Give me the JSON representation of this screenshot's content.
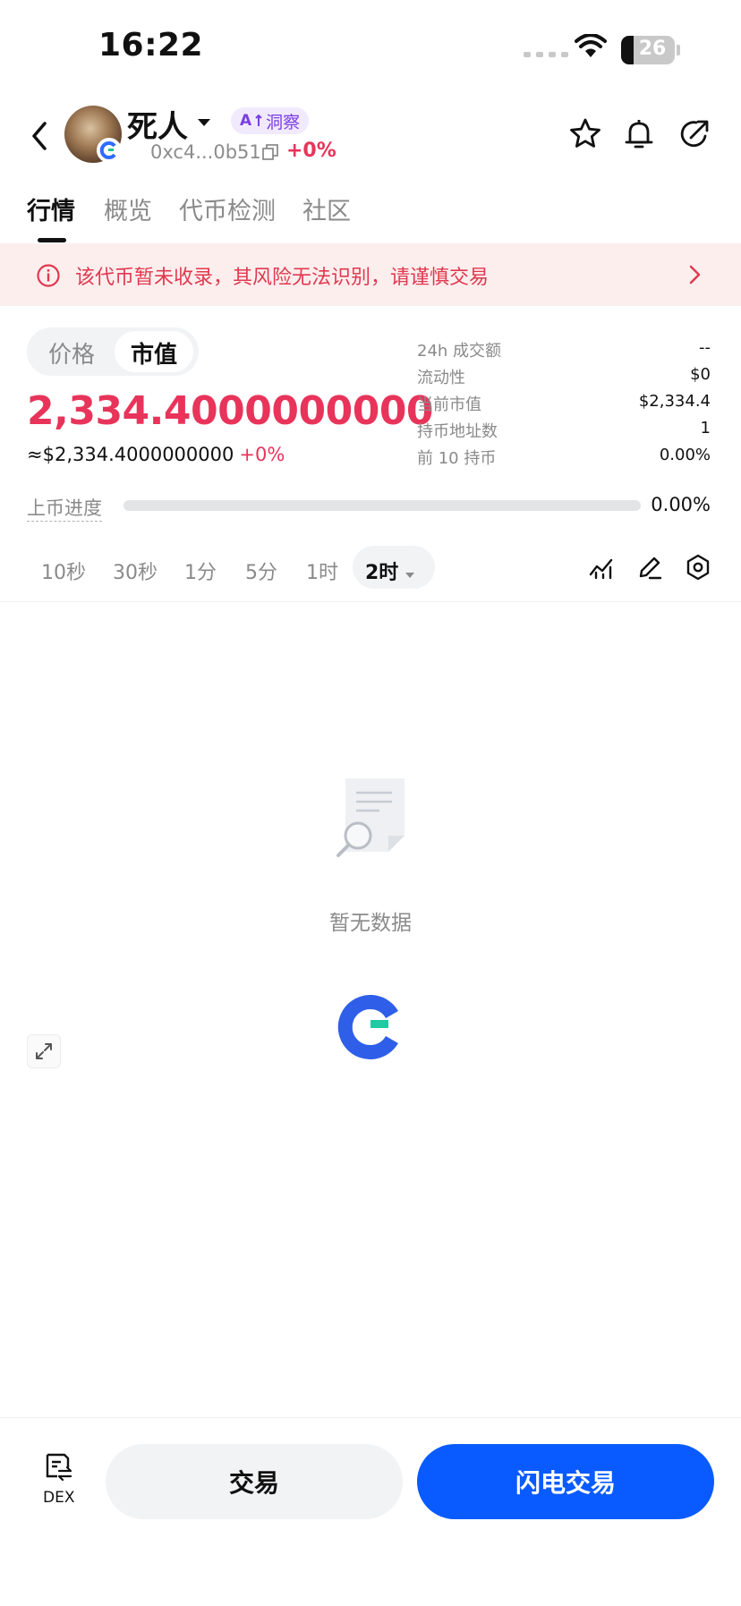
{
  "status_bar": {
    "time": "16:22",
    "battery": "26"
  },
  "header": {
    "token_name": "死人",
    "ai_badge_prefix": "A",
    "ai_badge_label": "洞察",
    "address": "0xc4...0b51",
    "change": "+0%"
  },
  "tabs": [
    {
      "label": "行情",
      "active": true
    },
    {
      "label": "概览",
      "active": false
    },
    {
      "label": "代币检测",
      "active": false
    },
    {
      "label": "社区",
      "active": false
    }
  ],
  "warning": {
    "text": "该代币暂未收录，其风险无法识别，请谨慎交易"
  },
  "price_toggle": {
    "options": [
      "价格",
      "市值"
    ],
    "selected": "市值"
  },
  "main_value": "2,334.4000000000",
  "usd_value": "≈$2,334.4000000000",
  "usd_change": "+0%",
  "stats": [
    {
      "label": "24h 成交额",
      "value": "--"
    },
    {
      "label": "流动性",
      "value": "$0"
    },
    {
      "label": "当前市值",
      "value": "$2,334.4"
    },
    {
      "label": "持币地址数",
      "value": "1"
    },
    {
      "label": "前 10 持币",
      "value": "0.00%"
    }
  ],
  "progress": {
    "label": "上币进度",
    "value_text": "0.00%",
    "fraction": 0.0
  },
  "intervals": {
    "items": [
      "10秒",
      "30秒",
      "1分",
      "5分",
      "1时",
      "2时"
    ],
    "selected": "2时"
  },
  "chart": {
    "empty_text": "暂无数据"
  },
  "bottom_bar": {
    "dex_label": "DEX",
    "trade_label": "交易",
    "flash_trade_label": "闪电交易"
  },
  "colors": {
    "accent_red": "#e8345a",
    "primary_blue": "#0a5bff",
    "warning_bg": "#fdeeee",
    "ai_purple": "#7b3fe4"
  }
}
